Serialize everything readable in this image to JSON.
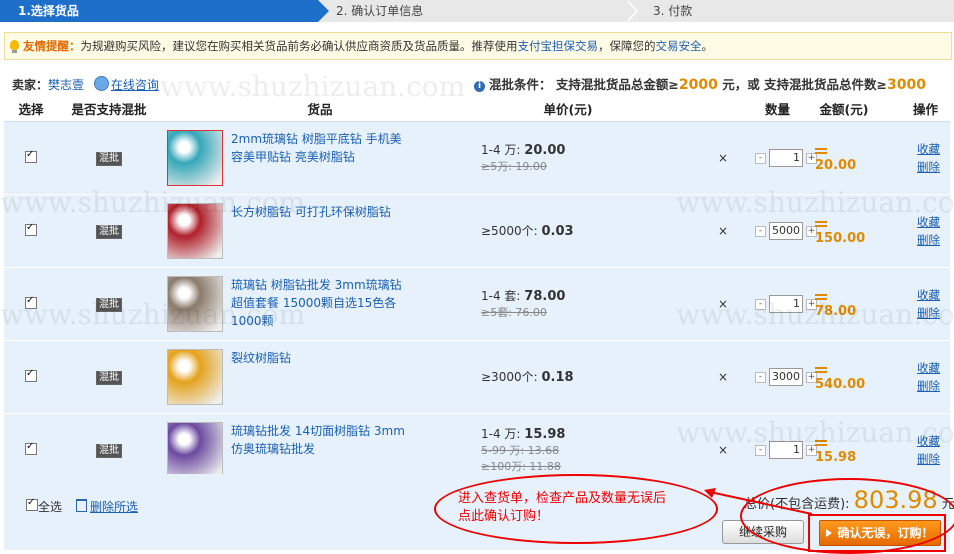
{
  "steps": [
    "1.选择货品",
    "2. 确认订单信息",
    "3. 付款"
  ],
  "tip": {
    "title": "友情提醒：",
    "text_before": "为规避购买风险，建议您在购买相关货品前务必确认供应商资质及货品质量。推荐使用",
    "link1": "支付宝担保交易",
    "text_mid": "，保障您的",
    "link2": "交易安全",
    "text_end": "。"
  },
  "seller": {
    "label": "卖家：",
    "name": "樊志壹",
    "chat": "在线咨询"
  },
  "condition": {
    "label": "混批条件：",
    "text1": "支持混批货品总金额≥",
    "amount": "2000",
    "text2": "元，或 支持混批货品总件数≥",
    "count": "3000"
  },
  "headers": [
    "选择",
    "是否支持混批",
    "货品",
    "单价(元)",
    "数量",
    "金额(元)",
    "操作"
  ],
  "mix_label": "混批",
  "items": [
    {
      "name": "2mm琉璃钻 树脂平底钻 手机美容美甲贴钻 亮美树脂钻",
      "price_lines": [
        {
          "range": "1-4 万:",
          "price": "20.00",
          "strike": false
        },
        {
          "range": "≥5万:",
          "price": "19.00",
          "strike": true
        }
      ],
      "qty": "1",
      "amount": "20.00",
      "color": "#35a7b8"
    },
    {
      "name": "长方树脂钻 可打孔环保树脂钻",
      "price_lines": [
        {
          "range": "≥5000个:",
          "price": "0.03",
          "strike": false
        }
      ],
      "qty": "5000",
      "amount": "150.00",
      "color": "#b0202a"
    },
    {
      "name": "琉璃钻 树脂钻批发 3mm琉璃钻超值套餐 15000颗自选15色各1000颗",
      "price_lines": [
        {
          "range": "1-4 套:",
          "price": "78.00",
          "strike": false
        },
        {
          "range": "≥5套:",
          "price": "76.00",
          "strike": true
        }
      ],
      "qty": "1",
      "amount": "78.00",
      "color": "#8a7a6a"
    },
    {
      "name": "裂纹树脂钻",
      "price_lines": [
        {
          "range": "≥3000个:",
          "price": "0.18",
          "strike": false
        }
      ],
      "qty": "3000",
      "amount": "540.00",
      "color": "#e4a21c"
    },
    {
      "name": "琉璃钻批发 14切面树脂钻 3mm仿奥琉璃钻批发",
      "price_lines": [
        {
          "range": "1-4 万:",
          "price": "15.98",
          "strike": false
        },
        {
          "range": "5-99 万:",
          "price": "13.68",
          "strike": true
        },
        {
          "range": "≥100万:",
          "price": "11.88",
          "strike": true
        }
      ],
      "qty": "1",
      "amount": "15.98",
      "color": "#6b4aa0"
    }
  ],
  "ops": {
    "fav": "收藏",
    "del": "删除"
  },
  "footer": {
    "select_all": "全选",
    "delete_selected": "删除所选",
    "total_label": "总价(不包含运费):",
    "total": "803.98",
    "unit": "元",
    "continue": "继续采购",
    "confirm": "确认无误，订购！"
  },
  "annotation": {
    "line1": "进入查货单，检查产品及数量无误后",
    "line2": "点此确认订购！"
  },
  "watermark": "www.shuzhizuan.com"
}
